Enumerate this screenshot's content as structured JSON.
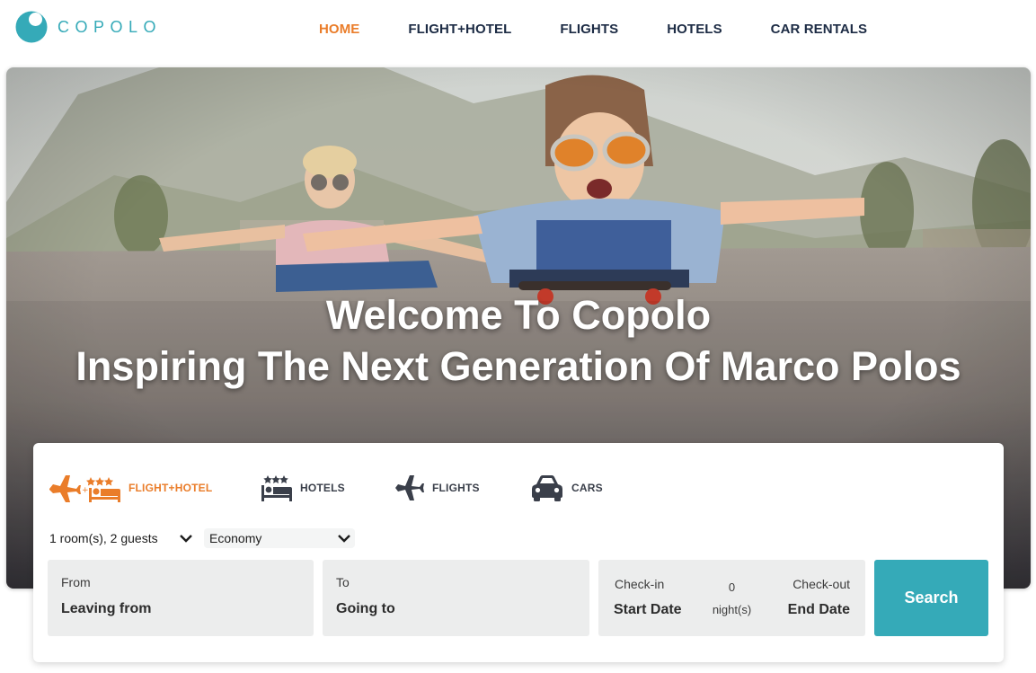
{
  "brand": {
    "name": "COPOLO",
    "accent": "#35aab8",
    "highlight": "#ea7d2a"
  },
  "nav": {
    "items": [
      {
        "label": "HOME",
        "active": true
      },
      {
        "label": "FLIGHT+HOTEL"
      },
      {
        "label": "FLIGHTS"
      },
      {
        "label": "HOTELS"
      },
      {
        "label": "CAR RENTALS"
      }
    ]
  },
  "hero": {
    "title": "Welcome To Copolo",
    "subtitle": "Inspiring The Next Generation Of Marco Polos"
  },
  "search": {
    "tabs": [
      {
        "label": "FLIGHT+HOTEL",
        "icon": "plane-bed-stars-icon",
        "active": true
      },
      {
        "label": "HOTELS",
        "icon": "bed-stars-icon"
      },
      {
        "label": "FLIGHTS",
        "icon": "plane-icon"
      },
      {
        "label": "CARS",
        "icon": "car-icon"
      }
    ],
    "rooms_guests": "1 room(s), 2 guests",
    "cabin_class": "Economy",
    "from": {
      "label": "From",
      "placeholder": "Leaving from"
    },
    "to": {
      "label": "To",
      "placeholder": "Going to"
    },
    "dates": {
      "checkin_label": "Check-in",
      "checkin_placeholder": "Start Date",
      "nights_count": "0",
      "nights_label": "night(s)",
      "checkout_label": "Check-out",
      "checkout_placeholder": "End Date"
    },
    "button_label": "Search"
  }
}
